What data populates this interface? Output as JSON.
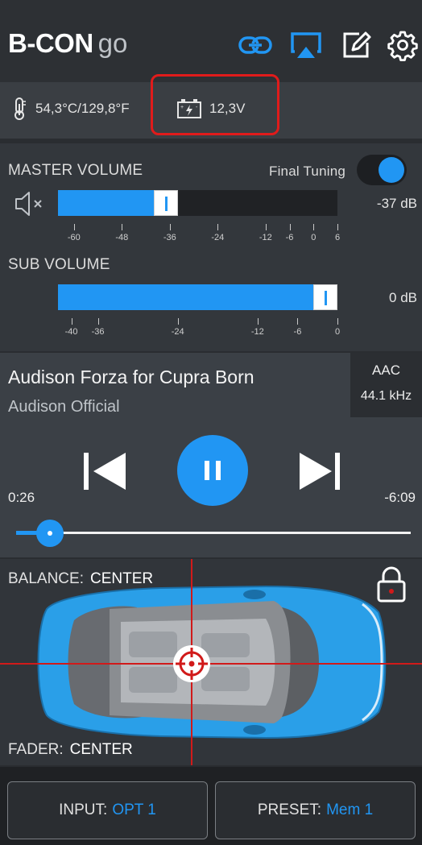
{
  "header": {
    "brand_bold": "B-CON",
    "brand_light": "go",
    "icons": [
      "link-icon",
      "airplay-icon",
      "edit-icon",
      "gear-icon"
    ],
    "accent": "#2196f3"
  },
  "status": {
    "temperature": "54,3°C/129,8°F",
    "voltage": "12,3V",
    "highlight_color": "#e01b1b"
  },
  "master_volume": {
    "label": "MASTER VOLUME",
    "final_tuning_label": "Final Tuning",
    "final_tuning_on": true,
    "value_text": "-37  dB",
    "level_db": -37,
    "scale_min": -64,
    "scale_max": 6,
    "ticks": [
      "-60",
      "-48",
      "-36",
      "-24",
      "-12",
      "-6",
      "0",
      "6"
    ]
  },
  "sub_volume": {
    "label": "SUB VOLUME",
    "value_text": "0  dB",
    "level_db": 0,
    "scale_min": -42,
    "scale_max": 0,
    "ticks": [
      "-40",
      "-36",
      "-24",
      "-12",
      "-6",
      "0"
    ]
  },
  "player": {
    "title": "Audison Forza for Cupra Born",
    "artist": "Audison Official",
    "codec": "AAC",
    "sample_rate": "44.1 kHz",
    "elapsed": "0:26",
    "remaining": "-6:09",
    "progress": 0.066
  },
  "balance_fader": {
    "balance_label": "BALANCE:",
    "balance_value": "CENTER",
    "fader_label": "FADER:",
    "fader_value": "CENTER",
    "car_color": "#2a9fe8",
    "crosshair_color": "#d11a1a"
  },
  "bottom": {
    "input_label": "INPUT:",
    "input_value": "OPT 1",
    "preset_label": "PRESET:",
    "preset_value": "Mem 1"
  }
}
